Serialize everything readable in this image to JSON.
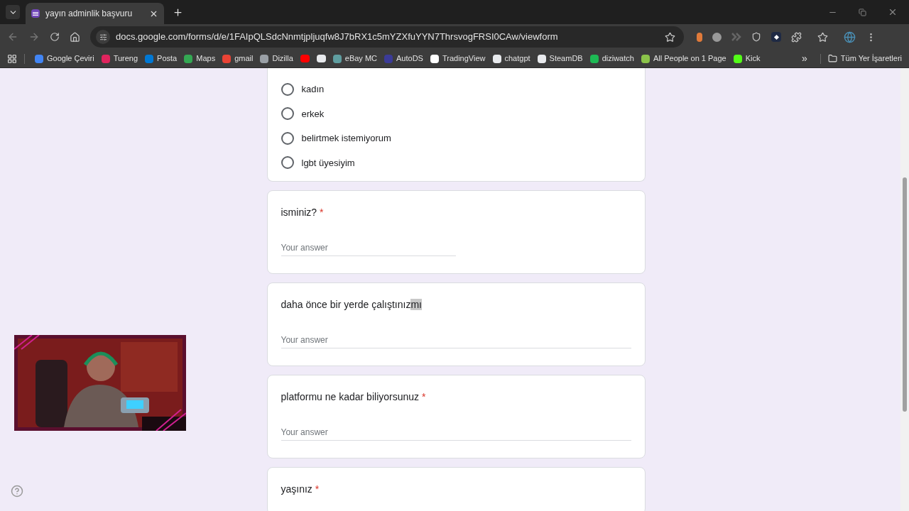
{
  "tab": {
    "title": "yayın adminlik başvuru",
    "selected": true
  },
  "address_bar": {
    "url": "docs.google.com/forms/d/e/1FAIpQLSdcNnmtjpljuqfw8J7bRX1c5mYZXfuYYN7ThrsvogFRSI0CAw/viewform"
  },
  "bookmarks": [
    {
      "kind": "link",
      "label": "Google Çeviri"
    },
    {
      "kind": "link",
      "label": "Tureng"
    },
    {
      "kind": "link",
      "label": "Posta"
    },
    {
      "kind": "link",
      "label": "Maps"
    },
    {
      "kind": "link",
      "label": "gmail"
    },
    {
      "kind": "link",
      "label": "Dizilla"
    },
    {
      "kind": "icon"
    },
    {
      "kind": "icon"
    },
    {
      "kind": "link",
      "label": "eBay MC"
    },
    {
      "kind": "link",
      "label": "AutoDS"
    },
    {
      "kind": "link",
      "label": "TradingView"
    },
    {
      "kind": "link",
      "label": "chatgpt"
    },
    {
      "kind": "link",
      "label": "SteamDB"
    },
    {
      "kind": "link",
      "label": "diziwatch"
    },
    {
      "kind": "link",
      "label": "All People on 1 Page"
    },
    {
      "kind": "link",
      "label": "Kick"
    }
  ],
  "bookmarks_overflow": "»",
  "all_bookmarks": "Tüm Yer İşaretleri",
  "form": {
    "choice_options": [
      {
        "label": "kadın",
        "selected": false
      },
      {
        "label": "erkek",
        "selected": false
      },
      {
        "label": "belirtmek istemiyorum",
        "selected": false
      },
      {
        "label": "lgbt üyesiyim",
        "selected": false
      }
    ],
    "questions": [
      {
        "title": "isminiz?",
        "required": true,
        "kind": "narrow",
        "placeholder": "Your answer"
      },
      {
        "title": "daha önce bir yerde çalıştınız",
        "selected_text": "mı",
        "required": false,
        "kind": "wide",
        "placeholder": "Your answer"
      },
      {
        "title": "platformu ne kadar biliyorsunuz",
        "required": true,
        "kind": "wide",
        "placeholder": "Your answer"
      },
      {
        "title": "yaşınız",
        "required": true,
        "kind": "none"
      }
    ],
    "required_mark": "*"
  }
}
